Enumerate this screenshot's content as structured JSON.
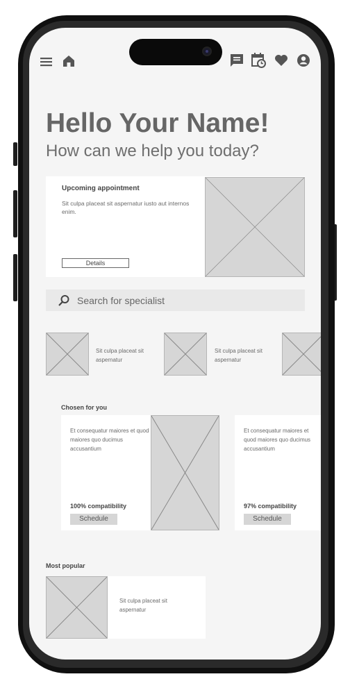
{
  "header": {
    "menu_icon": "hamburger-icon",
    "home_icon": "home-icon",
    "right_icons": [
      "chat-icon",
      "calendar-icon",
      "heart-icon",
      "user-icon"
    ]
  },
  "greeting": {
    "title": "Hello Your Name!",
    "subtitle": "How can we help you today?"
  },
  "appointment": {
    "heading": "Upcoming appointment",
    "body": "Sit culpa placeat sit aspernatur iusto aut internos enim.",
    "button_label": "Details"
  },
  "search": {
    "placeholder": "Search for specialist",
    "icon": "search-icon"
  },
  "specialists": [
    {
      "text": "Sit culpa placeat sit aspernatur"
    },
    {
      "text": "Sit culpa placeat sit aspernatur"
    }
  ],
  "chosen": {
    "heading": "Chosen for you",
    "cards": [
      {
        "body": "Et consequatur maiores et quod maiores quo ducimus accusantium",
        "compat": "100% compatibility",
        "button": "Schedule"
      },
      {
        "body": "Et consequatur maiores et quod maiores quo ducimus accusantium",
        "compat": "97% compatibility",
        "button": "Schedule"
      }
    ]
  },
  "popular": {
    "heading": "Most popular",
    "item_text": "Sit culpa placeat sit aspernatur"
  },
  "colors": {
    "screen_bg": "#f5f5f5",
    "placeholder": "#d6d6d6",
    "text": "#6b6b6b",
    "frame": "#101010"
  }
}
